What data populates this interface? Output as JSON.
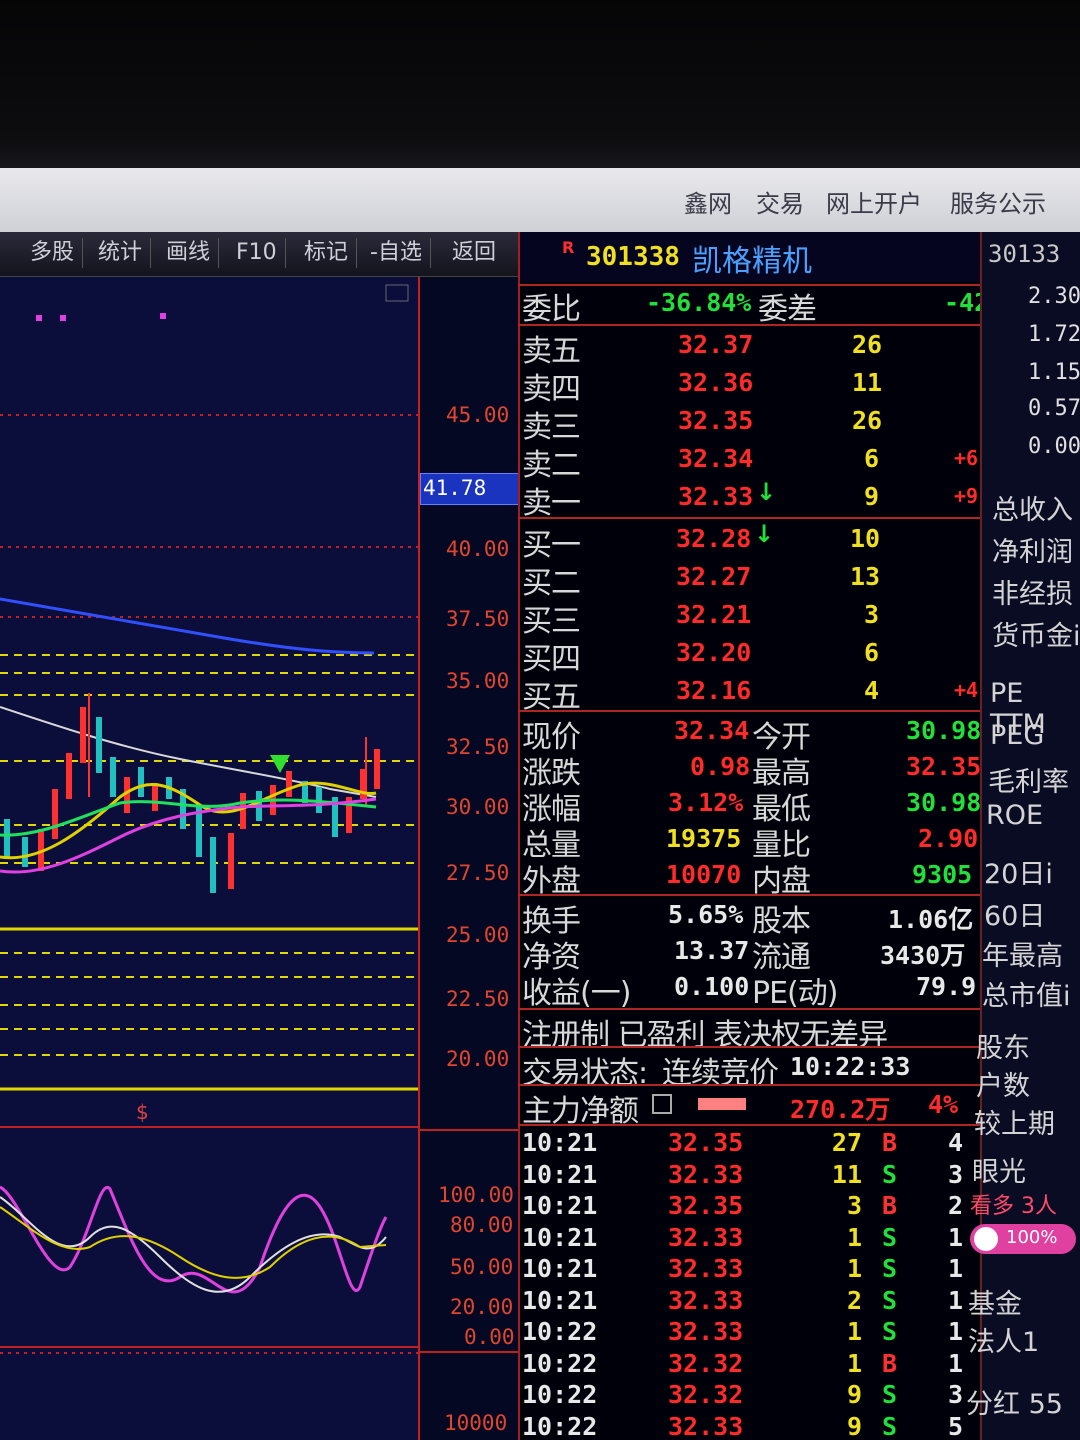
{
  "menu": [
    "鑫网",
    "交易",
    "网上开户",
    "服务公示"
  ],
  "toolbar": [
    "多股",
    "统计",
    "画线",
    "F10",
    "标记",
    "-自选",
    "返回"
  ],
  "axis": {
    "price_labels": [
      "45.00",
      "40.00",
      "37.50",
      "35.00",
      "32.50",
      "30.00",
      "27.50",
      "25.00",
      "22.50",
      "20.00"
    ],
    "cursor_value": "41.78",
    "ind_labels": [
      "100.00",
      "80.00",
      "50.00",
      "20.00",
      "0.00"
    ],
    "vol_label": "10000",
    "marker": "$"
  },
  "stock": {
    "flag": "R",
    "code": "301338",
    "name": "凯格精机"
  },
  "weibi": {
    "label": "委比",
    "value": "-36.84%",
    "diff_label": "委差",
    "diff": "-42"
  },
  "asks": [
    {
      "label": "卖五",
      "price": "32.37",
      "vol": "26",
      "chg": ""
    },
    {
      "label": "卖四",
      "price": "32.36",
      "vol": "11",
      "chg": ""
    },
    {
      "label": "卖三",
      "price": "32.35",
      "vol": "26",
      "chg": ""
    },
    {
      "label": "卖二",
      "price": "32.34",
      "vol": "6",
      "chg": "+6"
    },
    {
      "label": "卖一",
      "price": "32.33",
      "vol": "9",
      "chg": "+9"
    }
  ],
  "bids": [
    {
      "label": "买一",
      "price": "32.28",
      "vol": "10",
      "chg": ""
    },
    {
      "label": "买二",
      "price": "32.27",
      "vol": "13",
      "chg": ""
    },
    {
      "label": "买三",
      "price": "32.21",
      "vol": "3",
      "chg": ""
    },
    {
      "label": "买四",
      "price": "32.20",
      "vol": "6",
      "chg": ""
    },
    {
      "label": "买五",
      "price": "32.16",
      "vol": "4",
      "chg": "+4"
    }
  ],
  "stats": [
    {
      "l1": "现价",
      "v1": "32.34",
      "l2": "今开",
      "v2": "30.98"
    },
    {
      "l1": "涨跌",
      "v1": "0.98",
      "l2": "最高",
      "v2": "32.35"
    },
    {
      "l1": "涨幅",
      "v1": "3.12%",
      "l2": "最低",
      "v2": "30.98"
    },
    {
      "l1": "总量",
      "v1": "19375",
      "l2": "量比",
      "v2": "2.90"
    },
    {
      "l1": "外盘",
      "v1": "10070",
      "l2": "内盘",
      "v2": "9305"
    }
  ],
  "stats2": [
    {
      "l1": "换手",
      "v1": "5.65%",
      "l2": "股本",
      "v2": "1.06亿"
    },
    {
      "l1": "净资",
      "v1": "13.37",
      "l2": "流通",
      "v2": "3430万"
    },
    {
      "l1": "收益(一)",
      "v1": "0.100",
      "l2": "PE(动)",
      "v2": "79.9"
    }
  ],
  "notice": "注册制 已盈利 表决权无差异",
  "status": {
    "label": "交易状态:",
    "value": "连续竞价",
    "time": "10:22:33"
  },
  "flow": {
    "label": "主力净额",
    "value": "270.2万",
    "pct": "4%"
  },
  "ticks": [
    {
      "t": "10:21",
      "p": "32.35",
      "v": "27",
      "s": "B",
      "n": "4"
    },
    {
      "t": "10:21",
      "p": "32.33",
      "v": "11",
      "s": "S",
      "n": "3"
    },
    {
      "t": "10:21",
      "p": "32.35",
      "v": "3",
      "s": "B",
      "n": "2"
    },
    {
      "t": "10:21",
      "p": "32.33",
      "v": "1",
      "s": "S",
      "n": "1"
    },
    {
      "t": "10:21",
      "p": "32.33",
      "v": "1",
      "s": "S",
      "n": "1"
    },
    {
      "t": "10:21",
      "p": "32.33",
      "v": "2",
      "s": "S",
      "n": "1"
    },
    {
      "t": "10:22",
      "p": "32.33",
      "v": "1",
      "s": "S",
      "n": "1"
    },
    {
      "t": "10:22",
      "p": "32.32",
      "v": "1",
      "s": "B",
      "n": "1"
    },
    {
      "t": "10:22",
      "p": "32.32",
      "v": "9",
      "s": "S",
      "n": "3"
    },
    {
      "t": "10:22",
      "p": "32.33",
      "v": "9",
      "s": "S",
      "n": "5"
    }
  ],
  "right_panel": {
    "code": "30133",
    "values": [
      "2.30",
      "1.72",
      "1.15",
      "0.57",
      "0.00"
    ],
    "labels": [
      "总收入",
      "净利润",
      "非经损",
      "货币金i",
      "PE TTM",
      "PEG",
      "毛利率",
      "ROE",
      "20日i",
      "60日",
      "年最高",
      "总市值i",
      "股东",
      "户数",
      "较上期",
      "眼光",
      "看多 3人",
      "100%",
      "基金",
      "法人1",
      "分红 55"
    ]
  }
}
